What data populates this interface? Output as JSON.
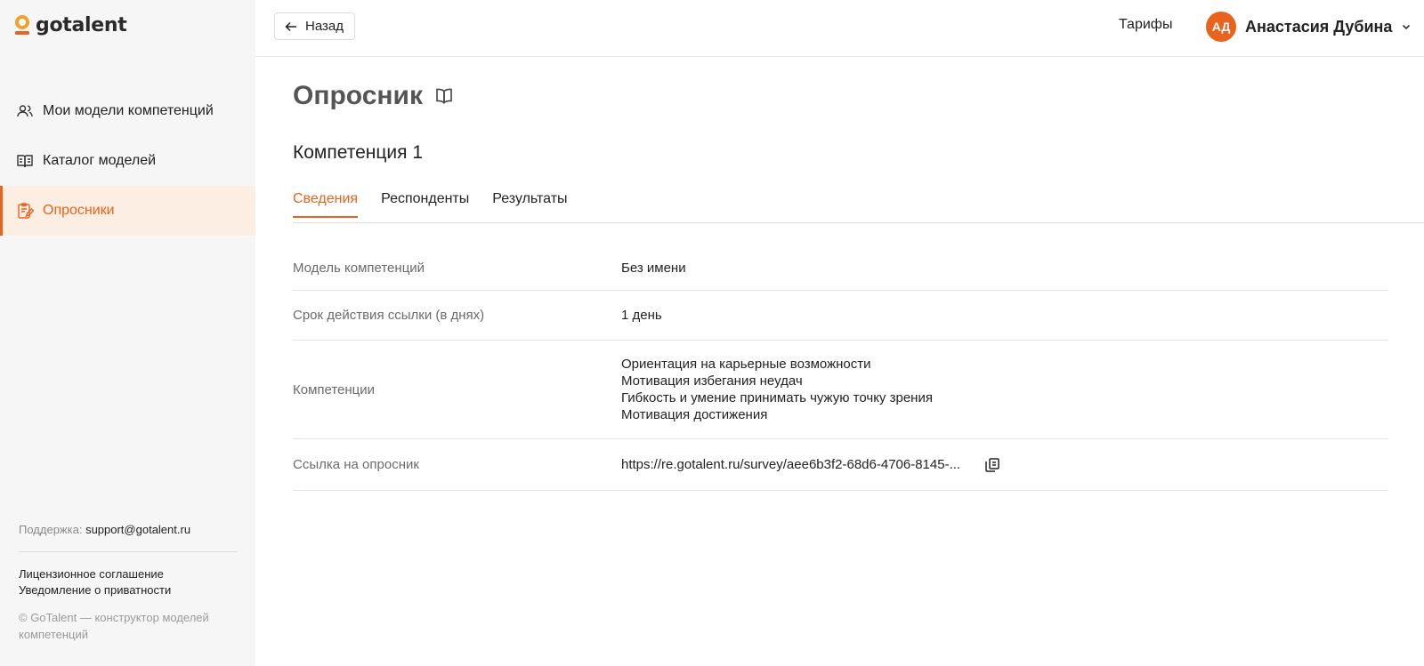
{
  "brand": {
    "name": "gotalent",
    "accent": "#e8631c"
  },
  "sidebar": {
    "items": [
      {
        "label": "Мои модели компетенций",
        "icon": "users-icon"
      },
      {
        "label": "Каталог моделей",
        "icon": "book-open-icon"
      },
      {
        "label": "Опросники",
        "icon": "clipboard-edit-icon",
        "active": true
      }
    ],
    "support_label": "Поддержка:",
    "support_email": "support@gotalent.ru",
    "license_link": "Лицензионное соглашение",
    "privacy_link": "Уведомление о приватности",
    "copyright": "© GoTalent — конструктор моделей компетенций"
  },
  "header": {
    "back_label": "Назад",
    "tariffs_label": "Тарифы",
    "user_initials": "АД",
    "user_name": "Анастасия Дубина"
  },
  "main": {
    "title": "Опросник",
    "subtitle": "Компетенция 1",
    "tabs": [
      {
        "label": "Сведения",
        "active": true
      },
      {
        "label": "Респонденты"
      },
      {
        "label": "Результаты"
      }
    ],
    "info": {
      "model_label": "Модель компетенций",
      "model_value": "Без имени",
      "expiry_label": "Срок действия ссылки (в днях)",
      "expiry_value": "1 день",
      "competencies_label": "Компетенции",
      "competencies": [
        "Ориентация на карьерные возможности",
        "Мотивация избегания неудач",
        "Гибкость и умение принимать чужую точку зрения",
        "Мотивация достижения"
      ],
      "link_label": "Ссылка на опросник",
      "link_value": "https://re.gotalent.ru/survey/aee6b3f2-68d6-4706-8145-..."
    }
  }
}
